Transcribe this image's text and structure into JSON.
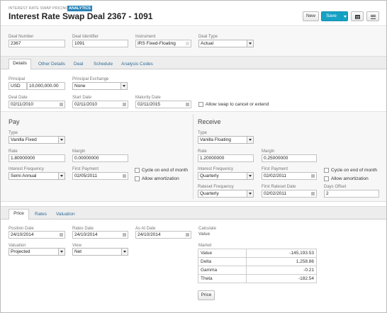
{
  "header": {
    "app_name": "INTEREST RATE SWAP PRICING",
    "badge": "ANALYTICS",
    "title": "Interest Rate Swap Deal 2367 - 1091",
    "new_label": "New",
    "save_label": "Save"
  },
  "deal": {
    "deal_number_label": "Deal Number",
    "deal_number": "2367",
    "deal_identifier_label": "Deal Identifier",
    "deal_identifier": "1091",
    "instrument_label": "Instrument",
    "instrument": "IRS Fixed-Floating",
    "deal_type_label": "Deal Type",
    "deal_type": "Actual"
  },
  "tabs": [
    "Details",
    "Other Details",
    "Deal",
    "Schedule",
    "Analysis Codes"
  ],
  "details": {
    "principal_label": "Principal",
    "currency": "USD",
    "principal": "10,000,000.00",
    "principal_exchange_label": "Principal Exchange",
    "principal_exchange": "None",
    "deal_date_label": "Deal Date",
    "deal_date": "02/11/2010",
    "start_date_label": "Start Date",
    "start_date": "02/11/2010",
    "maturity_date_label": "Maturity Date",
    "maturity_date": "02/11/2015",
    "allow_cancel_label": "Allow swap to cancel or extend"
  },
  "pay": {
    "title": "Pay",
    "type_label": "Type",
    "type": "Vanilla Fixed",
    "rate_label": "Rate",
    "rate": "1.80000000",
    "margin_label": "Margin",
    "margin": "0.00000000",
    "interest_frequency_label": "Interest Frequency",
    "interest_frequency": "Semi Annual",
    "first_payment_label": "First Payment",
    "first_payment": "02/05/2011",
    "cycle_label": "Cycle on end of month",
    "amortization_label": "Allow amortization"
  },
  "receive": {
    "title": "Receive",
    "type_label": "Type",
    "type": "Vanilla Floating",
    "rate_label": "Rate",
    "rate": "1.20000000",
    "margin_label": "Margin",
    "margin": "0.25000000",
    "interest_frequency_label": "Interest Frequency",
    "interest_frequency": "Quarterly",
    "first_payment_label": "First Payment",
    "first_payment": "02/02/2011",
    "cycle_label": "Cycle on end of month",
    "amortization_label": "Allow amortization",
    "rateset_frequency_label": "Rateset Frequency",
    "rateset_frequency": "Quarterly",
    "first_rateset_label": "First Rateset Date",
    "first_rateset": "02/02/2011",
    "days_offset_label": "Days Offset",
    "days_offset": "2"
  },
  "price_tabs": [
    "Price",
    "Rates",
    "Valuation"
  ],
  "price": {
    "position_date_label": "Position Date",
    "position_date": "24/10/2014",
    "rates_date_label": "Rates Date",
    "rates_date": "24/10/2014",
    "as_at_date_label": "As At Date",
    "as_at_date": "24/10/2014",
    "calculate_label": "Calculate",
    "calculate_value": "Value",
    "valuation_label": "Valuation",
    "valuation": "Projected",
    "view_label": "View",
    "view": "Net",
    "market_label": "Market",
    "market_rows": [
      {
        "name": "Value",
        "value": "-145,193.53"
      },
      {
        "name": "Delta",
        "value": "1,258.86"
      },
      {
        "name": "Gamma",
        "value": "-0.21"
      },
      {
        "name": "Theta",
        "value": "-182.54"
      }
    ],
    "price_button": "Price"
  },
  "colors": {
    "accent": "#17a2c4",
    "link": "#2f6d9a",
    "badge": "#2a83b8"
  }
}
